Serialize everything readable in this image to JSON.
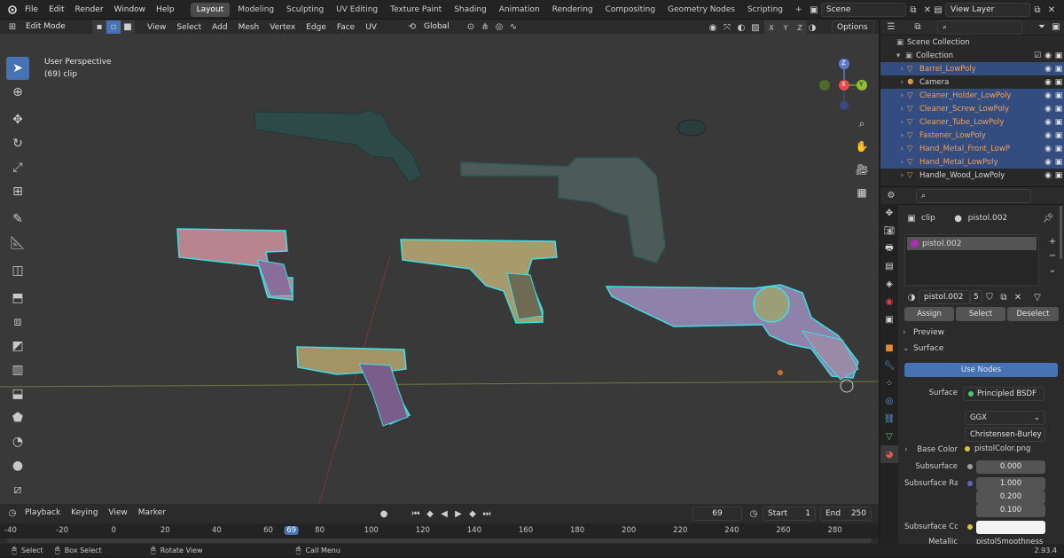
{
  "menu": [
    "File",
    "Edit",
    "Render",
    "Window",
    "Help"
  ],
  "workspaces": [
    "Layout",
    "Modeling",
    "Sculpting",
    "UV Editing",
    "Texture Paint",
    "Shading",
    "Animation",
    "Rendering",
    "Compositing",
    "Geometry Nodes",
    "Scripting",
    "+"
  ],
  "scene": {
    "name": "Scene",
    "view_layer": "View Layer"
  },
  "viewport_header": {
    "mode": "Edit Mode",
    "menus": [
      "View",
      "Select",
      "Add",
      "Mesh",
      "Vertex",
      "Edge",
      "Face",
      "UV"
    ],
    "orientation": "Global",
    "options": "Options",
    "axes": [
      "X",
      "Y",
      "Z"
    ]
  },
  "viewport_overlay": {
    "title": "User Perspective",
    "subtitle": "(69) clip"
  },
  "gizmo": {
    "z": "Z",
    "y": "Y",
    "x": "X"
  },
  "outliner": {
    "root": "Scene Collection",
    "collection": "Collection",
    "items": [
      {
        "name": "Barrel_LowPoly",
        "selected": true,
        "orange": true
      },
      {
        "name": "Camera",
        "selected": false,
        "orange": false
      },
      {
        "name": "Cleaner_Holder_LowPoly",
        "selected": true,
        "orange": true
      },
      {
        "name": "Cleaner_Screw_LowPoly",
        "selected": true,
        "orange": true
      },
      {
        "name": "Cleaner_Tube_LowPoly",
        "selected": true,
        "orange": true
      },
      {
        "name": "Fastener_LowPoly",
        "selected": true,
        "orange": true
      },
      {
        "name": "Hand_Metal_Front_LowP",
        "selected": true,
        "orange": true
      },
      {
        "name": "Hand_Metal_LowPoly",
        "selected": true,
        "orange": true
      },
      {
        "name": "Handle_Wood_LowPoly",
        "selected": false,
        "orange": false
      }
    ]
  },
  "properties": {
    "object": "clip",
    "material": "pistol.002",
    "slot": "pistol.002",
    "slot_users": "5",
    "assign": "Assign",
    "select": "Select",
    "deselect": "Deselect",
    "preview": "Preview",
    "surface_panel": "Surface",
    "use_nodes": "Use Nodes",
    "surface_label": "Surface",
    "surface_value": "Principled BSDF",
    "distribution": "GGX",
    "subsurface_method": "Christensen-Burley",
    "base_color_label": "Base Color",
    "base_color_value": "pistolColor.png",
    "subsurface_label": "Subsurface",
    "subsurface_value": "0.000",
    "subsurface_radius_label": "Subsurface Ra...",
    "subsurface_radius": [
      "1.000",
      "0.200",
      "0.100"
    ],
    "subsurface_color_label": "Subsurface Col...",
    "metallic_label": "Metallic",
    "metallic_value": "pistolSmoothness"
  },
  "timeline": {
    "menus": [
      "Playback",
      "Keying",
      "View",
      "Marker"
    ],
    "current_frame": "69",
    "start_label": "Start",
    "start": "1",
    "end_label": "End",
    "end": "250",
    "ticks": [
      "-40",
      "-20",
      "0",
      "20",
      "40",
      "60",
      "69",
      "80",
      "100",
      "120",
      "140",
      "160",
      "180",
      "200",
      "220",
      "240",
      "260",
      "280"
    ]
  },
  "status": {
    "select": "Select",
    "box_select": "Box Select",
    "rotate_view": "Rotate View",
    "call_menu": "Call Menu",
    "version": "2.93.4"
  },
  "colors": {
    "accent": "#4772b3",
    "selected_row": "#334d80",
    "wire": "#3ee0e6",
    "orange_text": "#f0a156",
    "viewport_bg": "#393939"
  }
}
